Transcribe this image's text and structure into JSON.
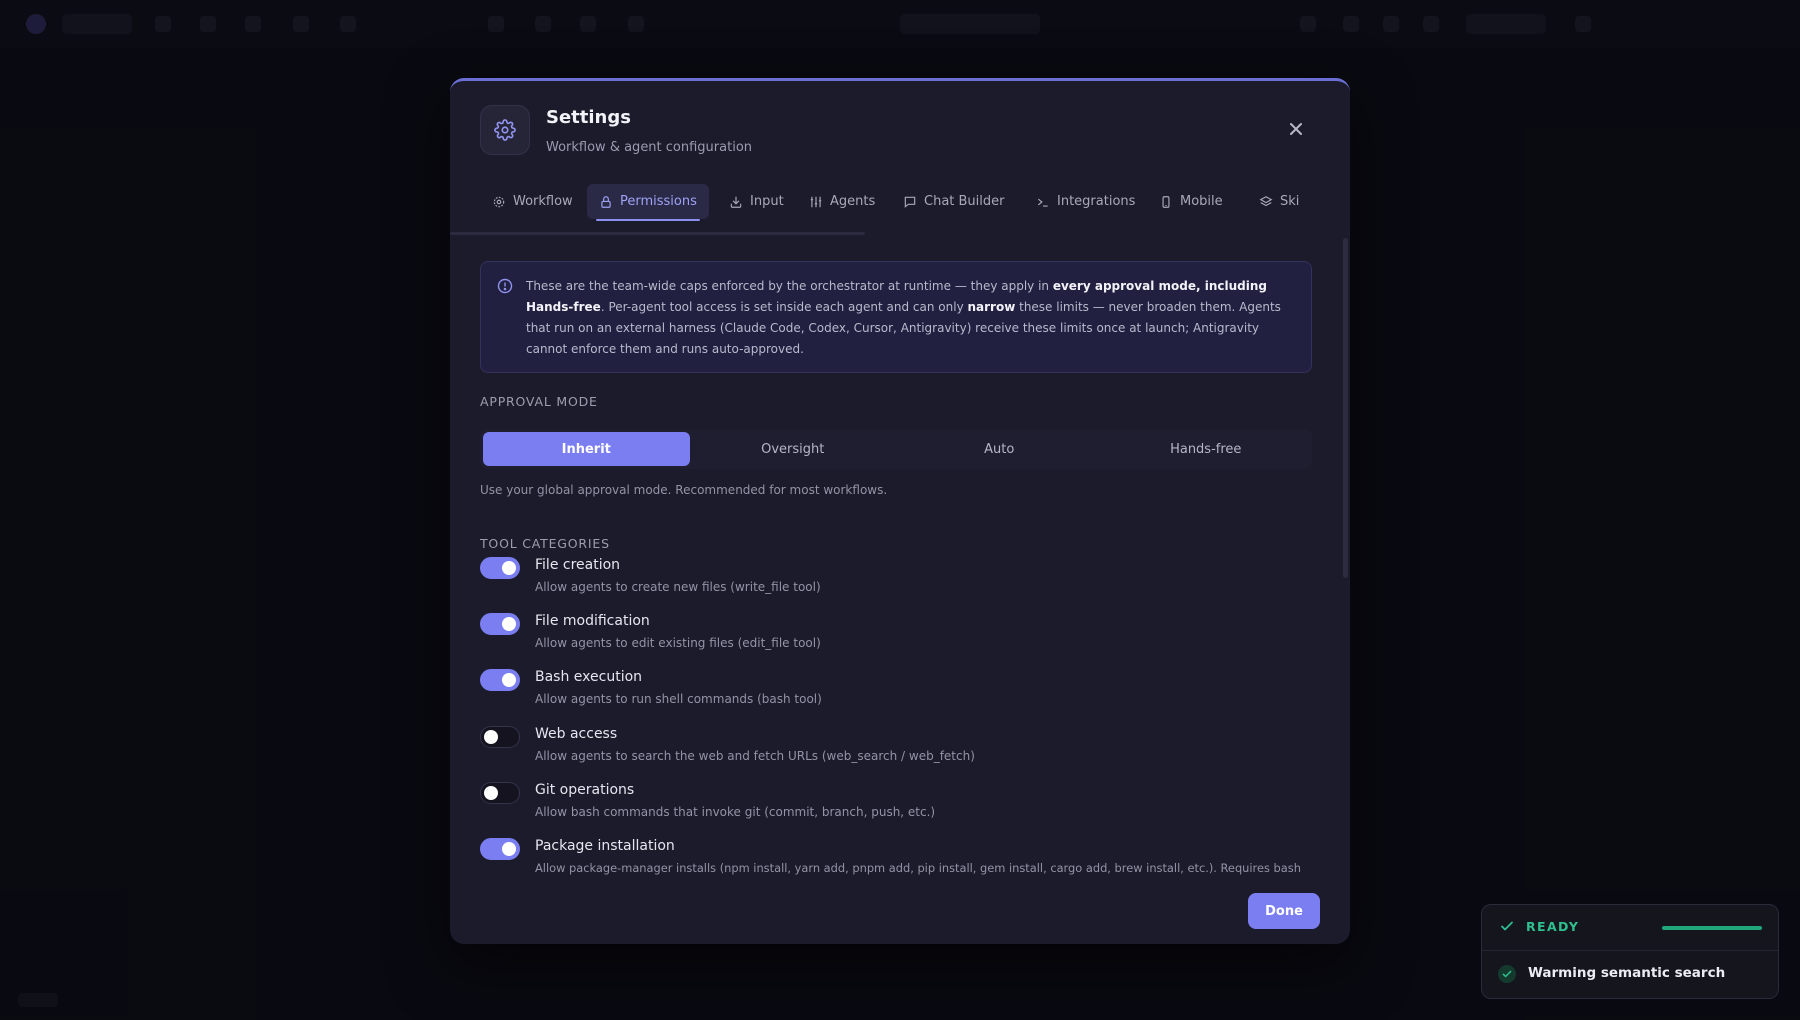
{
  "modal": {
    "title": "Settings",
    "subtitle": "Workflow & agent configuration",
    "tabs": [
      {
        "label": "Workflow",
        "icon": "gear-icon"
      },
      {
        "label": "Permissions",
        "icon": "lock-icon",
        "active": true
      },
      {
        "label": "Input",
        "icon": "download-icon"
      },
      {
        "label": "Agents",
        "icon": "sliders-icon"
      },
      {
        "label": "Chat Builder",
        "icon": "chat-icon"
      },
      {
        "label": "Integrations",
        "icon": "terminal-icon"
      },
      {
        "label": "Mobile",
        "icon": "phone-icon"
      },
      {
        "label": "Ski",
        "icon": "layers-icon"
      }
    ],
    "info": {
      "t1": "These are the team-wide caps enforced by the orchestrator at runtime — they apply in ",
      "b1": "every approval mode, including Hands-free",
      "t2": ". Per-agent tool access is set inside each agent and can only ",
      "b2": "narrow",
      "t3": " these limits — never broaden them. Agents that run on an external harness (Claude Code, Codex, Cursor, Antigravity) receive these limits once at launch; Antigravity cannot enforce them and runs auto-approved."
    },
    "approval": {
      "label": "APPROVAL MODE",
      "options": [
        "Inherit",
        "Oversight",
        "Auto",
        "Hands-free"
      ],
      "selected": "Inherit",
      "description": "Use your global approval mode. Recommended for most workflows."
    },
    "tools": {
      "label": "TOOL CATEGORIES",
      "items": [
        {
          "name": "File creation",
          "desc": "Allow agents to create new files (write_file tool)",
          "enabled": true
        },
        {
          "name": "File modification",
          "desc": "Allow agents to edit existing files (edit_file tool)",
          "enabled": true
        },
        {
          "name": "Bash execution",
          "desc": "Allow agents to run shell commands (bash tool)",
          "enabled": true
        },
        {
          "name": "Web access",
          "desc": "Allow agents to search the web and fetch URLs (web_search / web_fetch)",
          "enabled": false
        },
        {
          "name": "Git operations",
          "desc": "Allow bash commands that invoke git (commit, branch, push, etc.)",
          "enabled": false
        },
        {
          "name": "Package installation",
          "desc": "Allow package-manager installs (npm install, yarn add, pnpm add, pip install, gem install, cargo add, brew install, etc.). Requires bash",
          "enabled": true
        }
      ]
    },
    "done_label": "Done"
  },
  "toast": {
    "status": "READY",
    "message": "Warming semantic search"
  },
  "colors": {
    "accent": "#7b7ef0",
    "modal_bg": "#1c1b2b",
    "success": "#2fbf8f"
  }
}
